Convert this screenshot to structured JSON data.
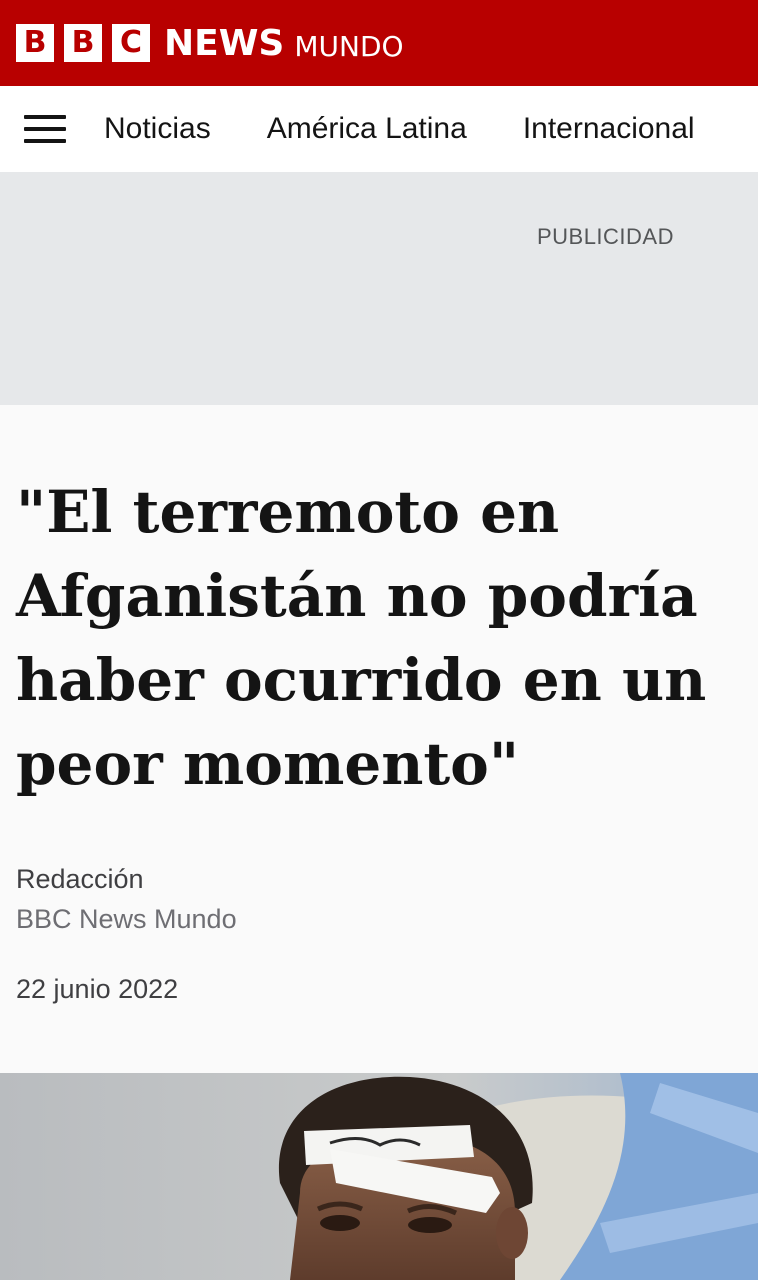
{
  "brand": {
    "blocks": [
      "B",
      "B",
      "C"
    ],
    "news": "NEWS",
    "edition": "MUNDO",
    "color": "#b80000"
  },
  "nav": {
    "menu_icon": "hamburger-menu-icon",
    "items": [
      "Noticias",
      "América Latina",
      "Internacional"
    ]
  },
  "ad": {
    "label": "PUBLICIDAD"
  },
  "article": {
    "headline": "\"El terremoto en Afganistán no podría haber ocurrido en un peor momento\"",
    "author": "Redacción",
    "organization": "BBC News Mundo",
    "date": "22 junio 2022"
  },
  "image": {
    "description_icon": "injured-boy-photo"
  }
}
